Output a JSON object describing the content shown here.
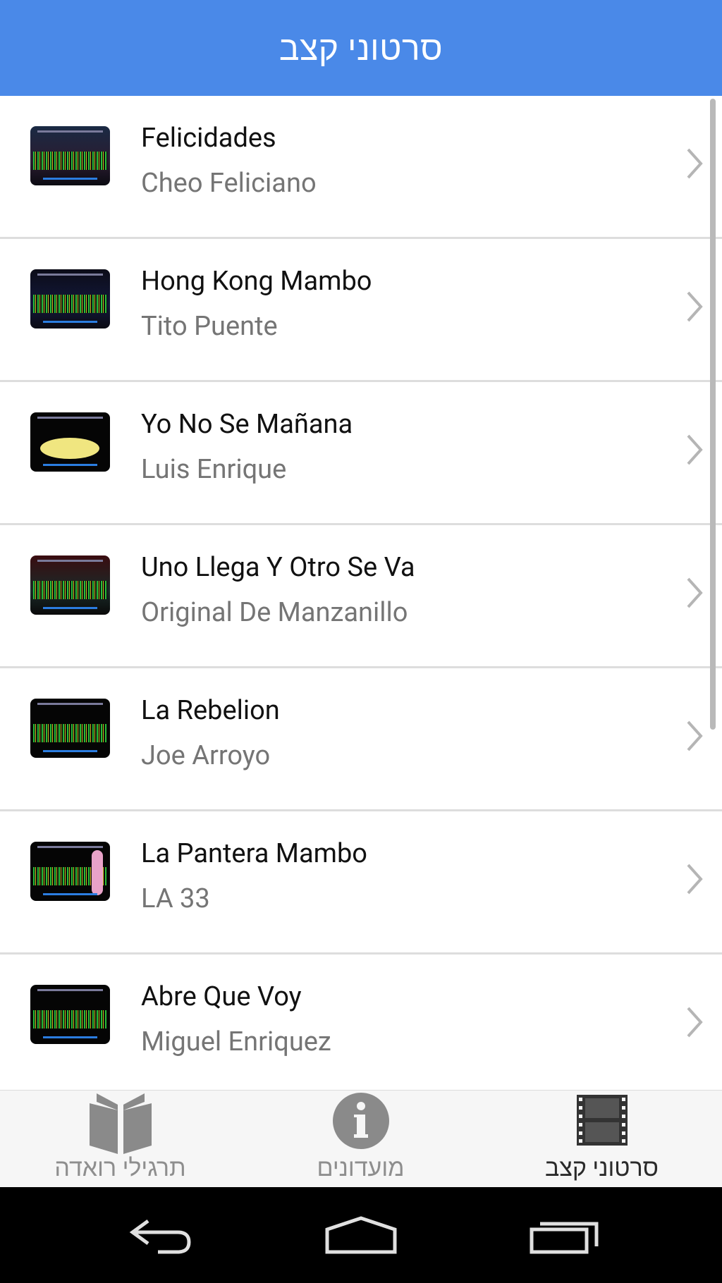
{
  "header": {
    "title": "סרטוני קצב"
  },
  "songs": [
    {
      "title": "Felicidades",
      "artist": "Cheo Feliciano"
    },
    {
      "title": "Hong Kong Mambo",
      "artist": "Tito Puente"
    },
    {
      "title": "Yo No Se Mañana",
      "artist": "Luis Enrique"
    },
    {
      "title": "Uno Llega Y Otro Se Va",
      "artist": "Original De Manzanillo"
    },
    {
      "title": "La Rebelion",
      "artist": "Joe Arroyo"
    },
    {
      "title": "La Pantera Mambo",
      "artist": "LA 33"
    },
    {
      "title": "Abre Que Voy",
      "artist": "Miguel Enriquez"
    }
  ],
  "tabs": [
    {
      "label": "תרגילי רואדה",
      "icon": "book-icon",
      "active": false
    },
    {
      "label": "מועדונים",
      "icon": "info-icon",
      "active": false
    },
    {
      "label": "סרטוני קצב",
      "icon": "film-icon",
      "active": true
    }
  ],
  "nav": {
    "back": "back-icon",
    "home": "home-icon",
    "recents": "recents-icon"
  },
  "colors": {
    "accent": "#4a89e8",
    "divider": "#dddddd",
    "tab_inactive": "#8e8e8e",
    "tab_active": "#2a2a2a"
  }
}
